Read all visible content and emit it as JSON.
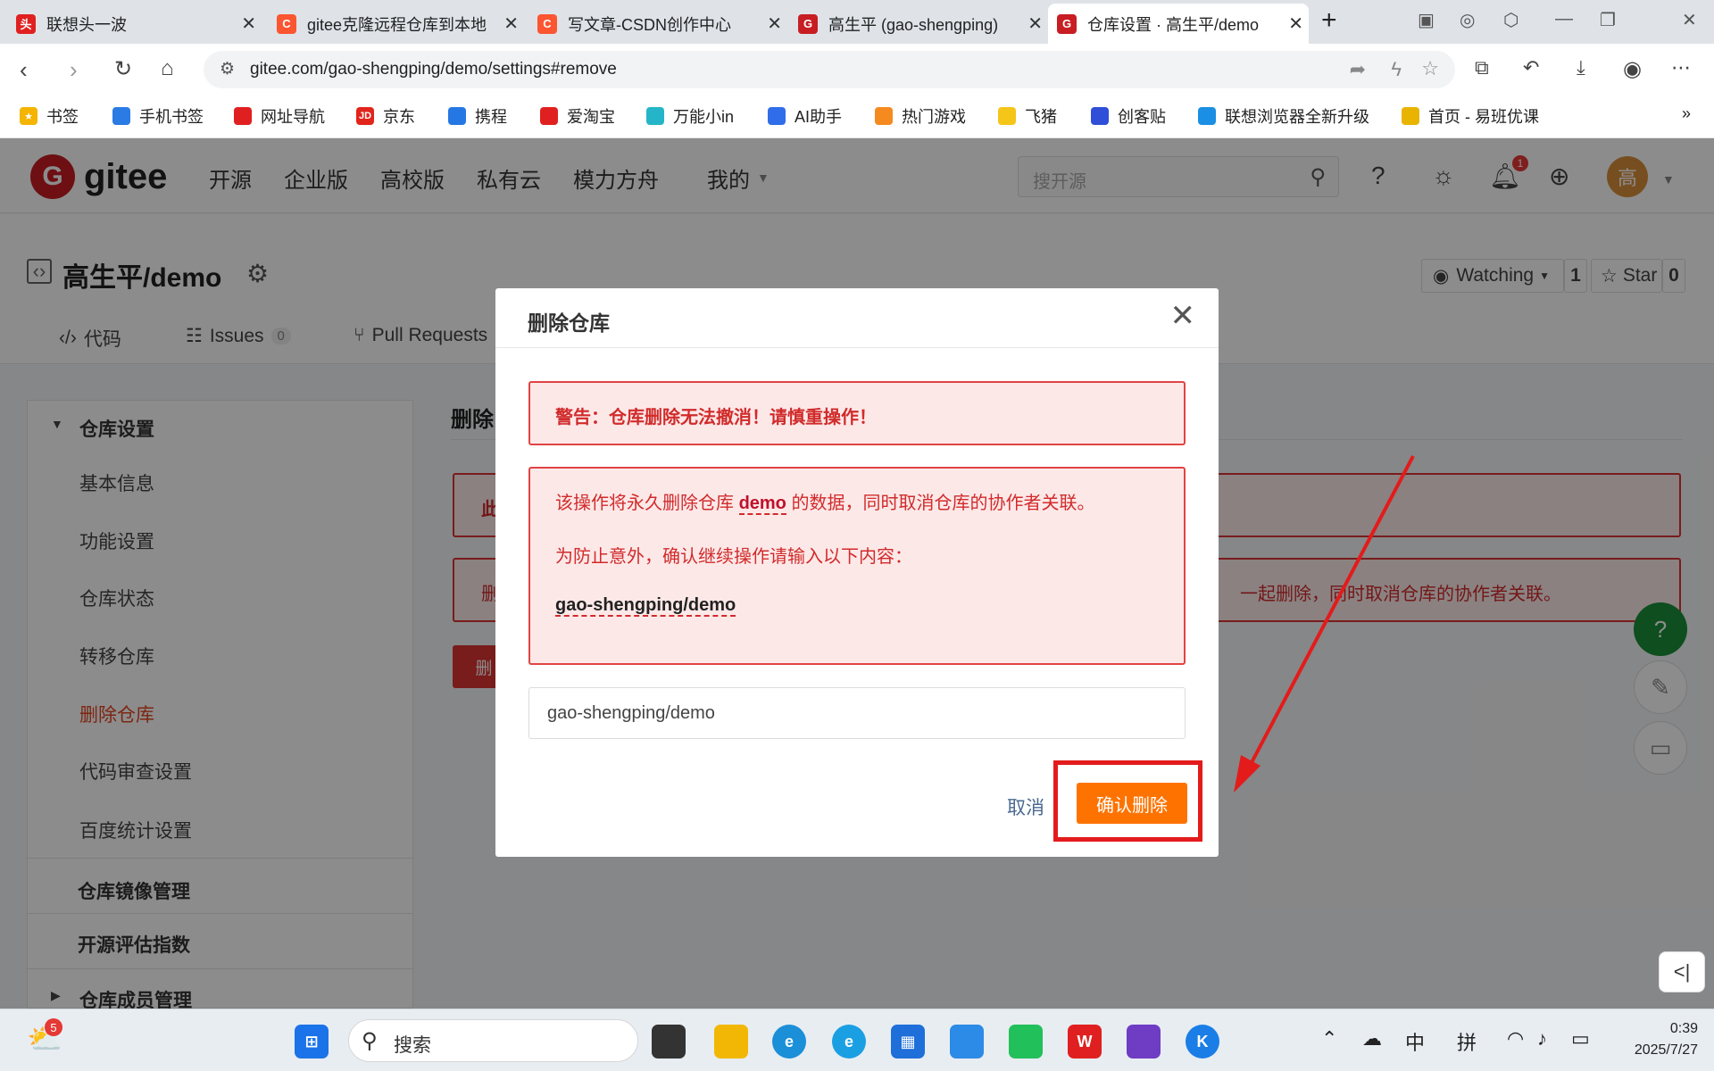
{
  "browser": {
    "tabs": [
      {
        "title": "联想头一波",
        "icon": "lenovo-icon",
        "color": "#e02020",
        "glyph": "头"
      },
      {
        "title": "gitee克隆远程仓库到本地",
        "icon": "csdn-icon",
        "color": "#fc5531",
        "glyph": "C"
      },
      {
        "title": "写文章-CSDN创作中心",
        "icon": "csdn-icon",
        "color": "#fc5531",
        "glyph": "C"
      },
      {
        "title": "高生平 (gao-shengping)",
        "icon": "gitee-icon",
        "color": "#c71d23",
        "glyph": "G"
      },
      {
        "title": "仓库设置 · 高生平/demo",
        "icon": "gitee-icon",
        "color": "#c71d23",
        "glyph": "G"
      }
    ],
    "new_tab": "+",
    "url": "gitee.com/gao-shengping/demo/settings#remove",
    "bookmarks": [
      {
        "label": "书签",
        "color": "#f4b400"
      },
      {
        "label": "手机书签",
        "color": "#2a7be4"
      },
      {
        "label": "网址导航",
        "color": "#e02020"
      },
      {
        "label": "京东",
        "color": "#e1251b"
      },
      {
        "label": "携程",
        "color": "#2577e3"
      },
      {
        "label": "爱淘宝",
        "color": "#e02020"
      },
      {
        "label": "万能小in",
        "color": "#25b5c9"
      },
      {
        "label": "AI助手",
        "color": "#2f6ee8"
      },
      {
        "label": "热门游戏",
        "color": "#f58a1f"
      },
      {
        "label": "飞猪",
        "color": "#f5c518"
      },
      {
        "label": "创客贴",
        "color": "#2f4fd8"
      },
      {
        "label": "联想浏览器全新升级",
        "color": "#1a8fe3"
      },
      {
        "label": "首页 - 易班优课",
        "color": "#e8b400"
      }
    ],
    "more_bookmarks": "»"
  },
  "gitee": {
    "logo_text": "gitee",
    "nav": [
      "开源",
      "企业版",
      "高校版",
      "私有云",
      "模力方舟",
      "我的"
    ],
    "search_placeholder": "搜开源",
    "notification_count": "1",
    "avatar_text": "高"
  },
  "repo": {
    "name": "高生平/demo",
    "watch_label": "Watching",
    "watch_count": "1",
    "star_label": "Star",
    "star_count": "0",
    "tabs": [
      {
        "label": "代码"
      },
      {
        "label": "Issues",
        "count": "0"
      },
      {
        "label": "Pull Requests"
      }
    ]
  },
  "sidebar": {
    "section": "仓库设置",
    "items": [
      "基本信息",
      "功能设置",
      "仓库状态",
      "转移仓库",
      "删除仓库",
      "代码审查设置",
      "百度统计设置"
    ],
    "active_item": "删除仓库",
    "groups": [
      "仓库镜像管理",
      "开源评估指数",
      "仓库成员管理"
    ]
  },
  "main": {
    "heading_partial": "删除",
    "box1_partial": "此",
    "box2_partial": "删",
    "box2_tail": "一起删除，同时取消仓库的协作者关联。",
    "button_partial": "删"
  },
  "dialog": {
    "title": "删除仓库",
    "warning": "警告：仓库删除无法撤消！请慎重操作！",
    "line1_pre": "该操作将永久删除仓库",
    "line1_repo": "demo",
    "line1_post": "的数据，同时取消仓库的协作者关联。",
    "line2": "为防止意外，确认继续操作请输入以下内容：",
    "confirm_text": "gao-shengping/demo",
    "input_value": "gao-shengping/demo",
    "cancel_label": "取消",
    "confirm_label": "确认删除"
  },
  "taskbar": {
    "weather_badge": "5",
    "search_label": "搜索",
    "ime_lang": "中",
    "ime_mode": "拼",
    "time": "0:39",
    "date": "2025/7/27"
  }
}
